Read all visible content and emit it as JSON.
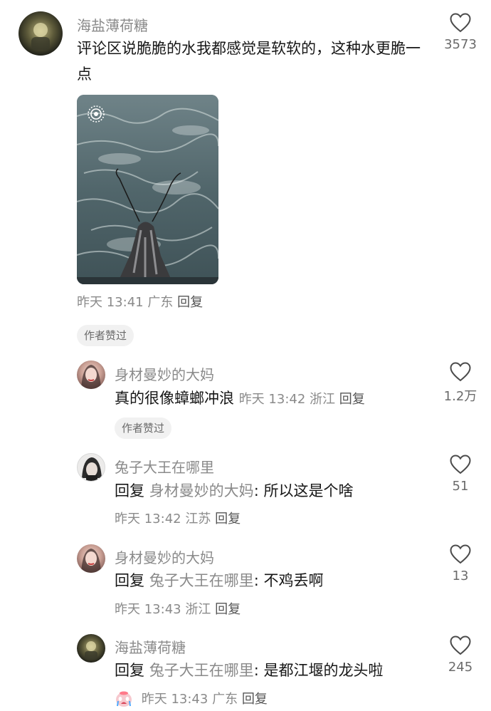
{
  "comments": [
    {
      "user": "海盐薄荷糖",
      "text": "评论区说脆脆的水我都感觉是软软的，这种水更脆一点",
      "meta": {
        "time": "昨天 13:41",
        "location": "广东",
        "reply": "回复"
      },
      "badge": "作者赞过",
      "likes": "3573",
      "image_icon": "live-photo-icon"
    },
    {
      "user": "身材曼妙的大妈",
      "text": "真的很像蟑螂冲浪",
      "meta": {
        "time": "昨天 13:42",
        "location": "浙江",
        "reply": "回复"
      },
      "badge": "作者赞过",
      "likes": "1.2万"
    },
    {
      "user": "兔子大王在哪里",
      "reply_prefix": "回复",
      "reply_to": "身材曼妙的大妈",
      "text": ": 所以这是个啥",
      "meta": {
        "time": "昨天 13:42",
        "location": "江苏",
        "reply": "回复"
      },
      "likes": "51"
    },
    {
      "user": "身材曼妙的大妈",
      "reply_prefix": "回复",
      "reply_to": "兔子大王在哪里",
      "text": ": 不鸡丢啊",
      "meta": {
        "time": "昨天 13:43",
        "location": "浙江",
        "reply": "回复"
      },
      "likes": "13"
    },
    {
      "user": "海盐薄荷糖",
      "reply_prefix": "回复",
      "reply_to": "兔子大王在哪里",
      "text": ": 是都江堰的龙头啦",
      "meta": {
        "time": "昨天 13:43",
        "location": "广东",
        "reply": "回复"
      },
      "likes": "245",
      "emoji": "crying-face-icon"
    }
  ]
}
